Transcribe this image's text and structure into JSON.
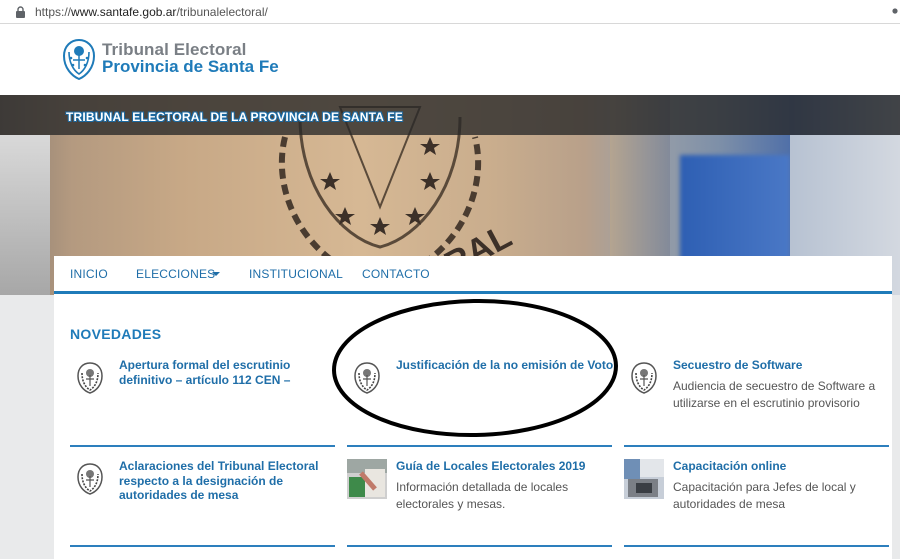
{
  "browser": {
    "url_prefix": "https://",
    "url_host": "www.santafe.gob.ar",
    "url_path": "/tribunalelectoral/"
  },
  "header": {
    "brand_line1": "Tribunal Electoral",
    "brand_line2": "Provincia de Santa Fe"
  },
  "hero": {
    "title": "TRIBUNAL ELECTORAL DE LA PROVINCIA DE SANTA FE"
  },
  "nav": {
    "items": [
      {
        "label": "INICIO"
      },
      {
        "label": "ELECCIONES"
      },
      {
        "label": "INSTITUCIONAL"
      },
      {
        "label": "CONTACTO"
      }
    ]
  },
  "news": {
    "title": "NOVEDADES",
    "items": [
      {
        "title": "Apertura formal del escrutinio definitivo – artículo 112 CEN –",
        "desc": "",
        "icon": "seal-icon"
      },
      {
        "title": "Justificación de la no emisión de Voto",
        "desc": "",
        "icon": "seal-icon"
      },
      {
        "title": "Secuestro de Software",
        "desc": "Audiencia de secuestro de Software a utilizarse en el escrutinio provisorio",
        "icon": "seal-icon"
      },
      {
        "title": "Aclaraciones del Tribunal Electoral respecto a la designación de autoridades de mesa",
        "desc": "",
        "icon": "seal-icon"
      },
      {
        "title": "Guía de Locales Electorales 2019",
        "desc": "Información detallada de locales electorales y mesas.",
        "icon": "ballot-photo"
      },
      {
        "title": "Capacitación online",
        "desc": "Capacitación para Jefes de local y autoridades de mesa",
        "icon": "training-photo"
      }
    ]
  },
  "colors": {
    "brand_blue": "#1f7bb9",
    "brand_gray": "#7a7f85",
    "annotation": "#000000"
  }
}
